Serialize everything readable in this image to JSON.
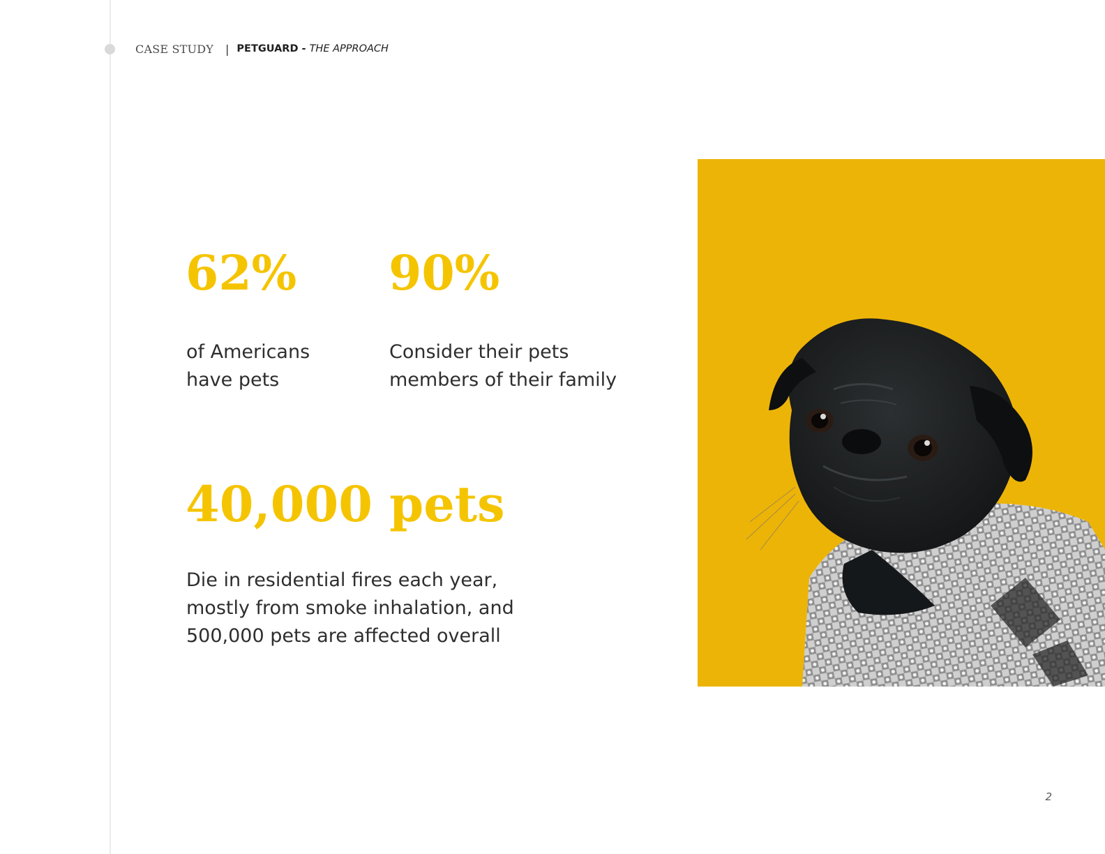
{
  "header": {
    "kicker": "CASE STUDY",
    "separator": "|",
    "brand": "PETGUARD -",
    "section": "THE APPROACH"
  },
  "stats": [
    {
      "value": "62%",
      "description_lines": [
        "of Americans",
        "have pets"
      ]
    },
    {
      "value": "90%",
      "description_lines": [
        "Consider their pets",
        "members of their family"
      ]
    },
    {
      "value": "40,000 pets",
      "description_lines": [
        "Die in residential fires each year,",
        "mostly from smoke inhalation, and",
        "500,000 pets are affected overall"
      ]
    }
  ],
  "photo": {
    "icon": "pug-in-sweater-photo",
    "background_color": "#edb408"
  },
  "page_number": "2",
  "colors": {
    "accent": "#f5c400",
    "text": "#2e2e2e",
    "photo_background": "#edb408",
    "timeline": "#ebebeb"
  }
}
